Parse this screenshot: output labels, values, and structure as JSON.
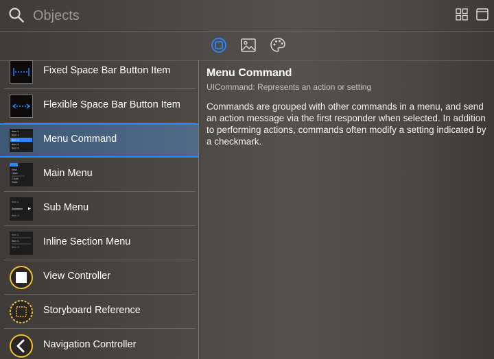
{
  "search": {
    "placeholder": "Objects"
  },
  "tabs": [
    {
      "name": "objects",
      "active": true
    },
    {
      "name": "media",
      "active": false
    },
    {
      "name": "colors",
      "active": false
    }
  ],
  "list": [
    {
      "label": "Fixed Space Bar Button Item",
      "icon": "fixed-space-thumbnail"
    },
    {
      "label": "Flexible Space Bar Button Item",
      "icon": "flexible-space-thumbnail"
    },
    {
      "label": "Menu Command",
      "icon": "menu-command-thumbnail",
      "selected": true,
      "thumb_text": [
        "Item 1",
        "Item 2",
        "Item 3",
        "Item 4",
        "Item 5"
      ]
    },
    {
      "label": "Main Menu",
      "icon": "main-menu-thumbnail",
      "thumb_text": [
        "New",
        "Open",
        "Close",
        "Save"
      ]
    },
    {
      "label": "Sub Menu",
      "icon": "sub-menu-thumbnail",
      "thumb_text": [
        "Item 1",
        "Submenu",
        "Item 3"
      ]
    },
    {
      "label": "Inline Section Menu",
      "icon": "inline-section-menu-thumbnail",
      "thumb_text": [
        "Item 1",
        "Item 1",
        "Item 3"
      ]
    },
    {
      "label": "View Controller",
      "icon": "view-controller-icon"
    },
    {
      "label": "Storyboard Reference",
      "icon": "storyboard-reference-icon"
    },
    {
      "label": "Navigation Controller",
      "icon": "navigation-controller-icon"
    }
  ],
  "detail": {
    "title": "Menu Command",
    "subtitle": "UICommand: Represents an action or setting",
    "description": "Commands are grouped with other commands in a menu, and send an action message via the first responder when selected. In addition to performing actions, commands often modify a setting indicated by a checkmark."
  },
  "colors": {
    "accent": "#2c86ff",
    "selection": "#4a6482",
    "controller_yellow": "#f2c230"
  }
}
